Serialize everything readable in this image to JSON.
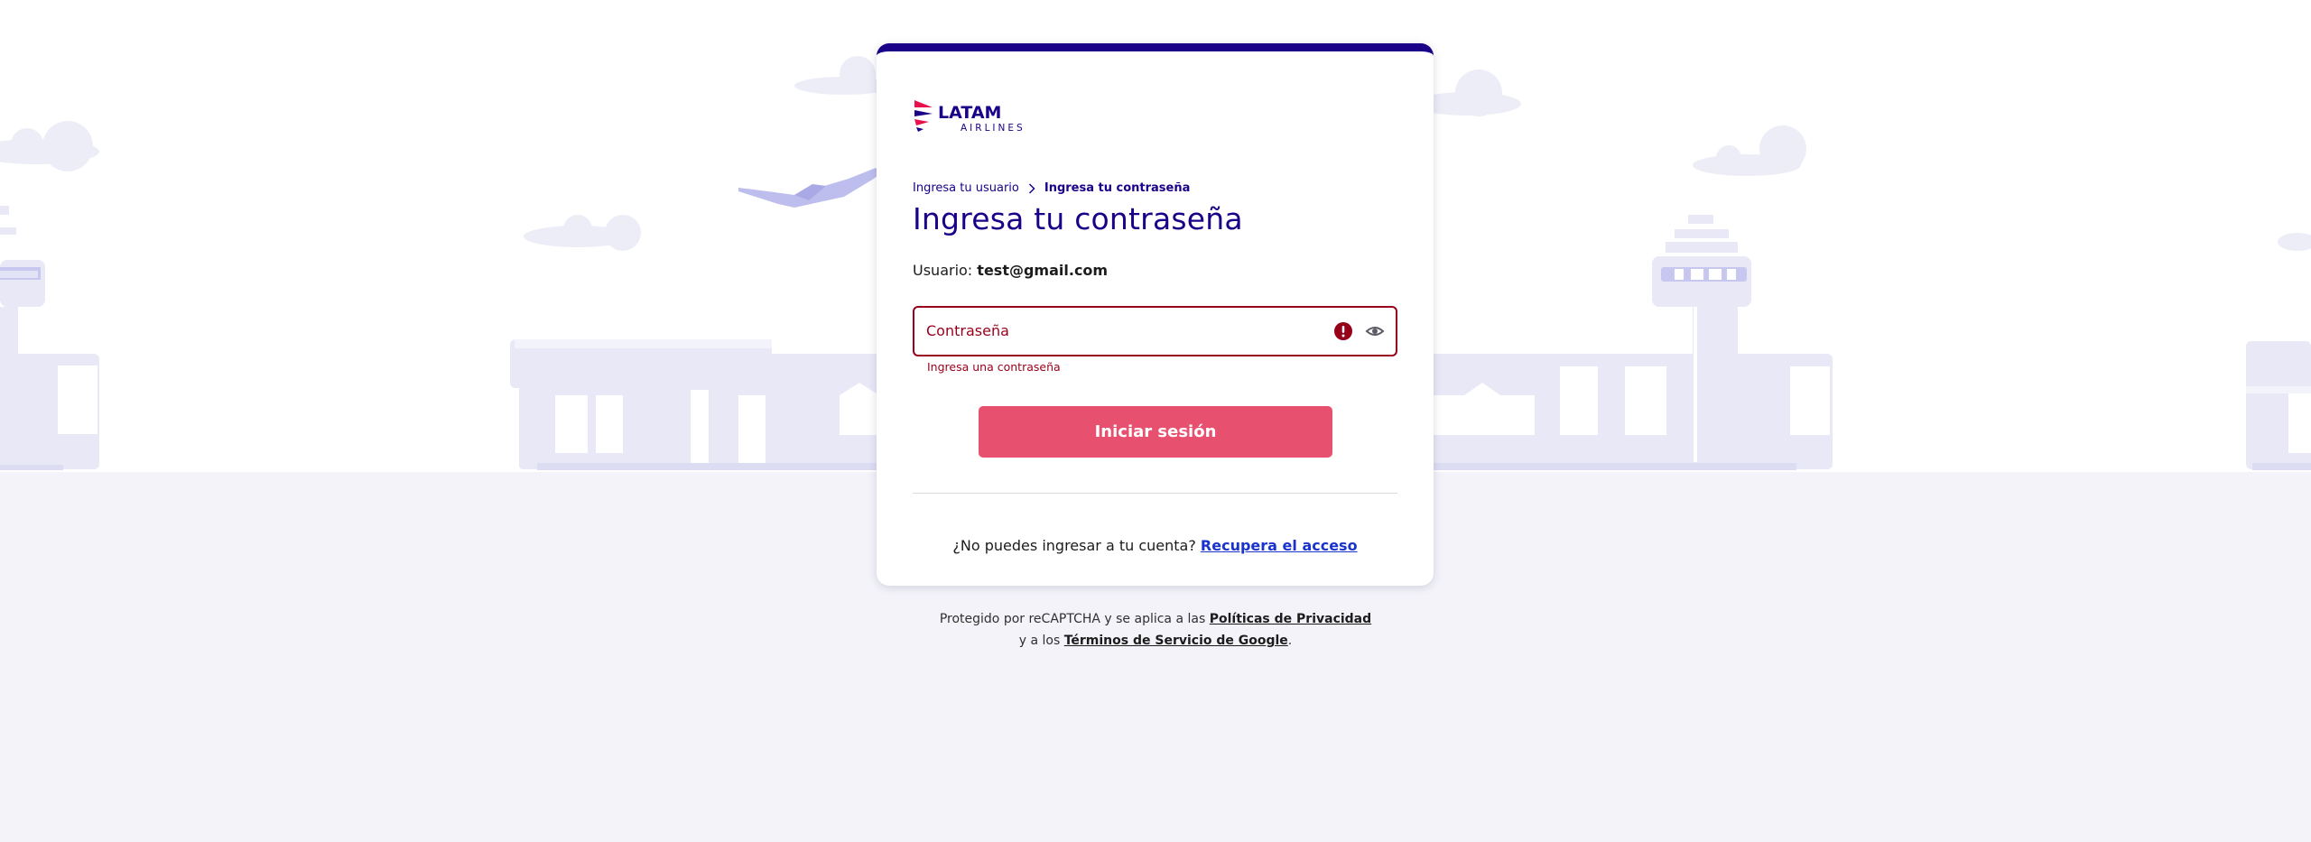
{
  "brand": {
    "name": "LATAM",
    "sub": "AIRLINES"
  },
  "breadcrumb": {
    "step1": "Ingresa tu usuario",
    "step2": "Ingresa tu contraseña"
  },
  "title": "Ingresa tu contraseña",
  "user": {
    "label": "Usuario:",
    "email": "test@gmail.com"
  },
  "password": {
    "label": "Contraseña",
    "value": "",
    "error": "Ingresa una contraseña"
  },
  "login_button": "Iniciar sesión",
  "help": {
    "text": "¿No puedes ingresar a tu cuenta?",
    "link": "Recupera el acceso"
  },
  "recaptcha": {
    "prefix": "Protegido por reCAPTCHA y se aplica a las",
    "privacy": "Políticas de Privacidad",
    "middle": "y a los",
    "terms": "Términos de Servicio de Google",
    "suffix": "."
  },
  "colors": {
    "brand": "#1b0088",
    "error": "#97001b",
    "button": "#e8506f",
    "link": "#1a33cc"
  },
  "icons": [
    "latam-logo-icon",
    "chevron-right-icon",
    "error-icon",
    "eye-icon",
    "airplane-icon",
    "cloud-icon"
  ]
}
